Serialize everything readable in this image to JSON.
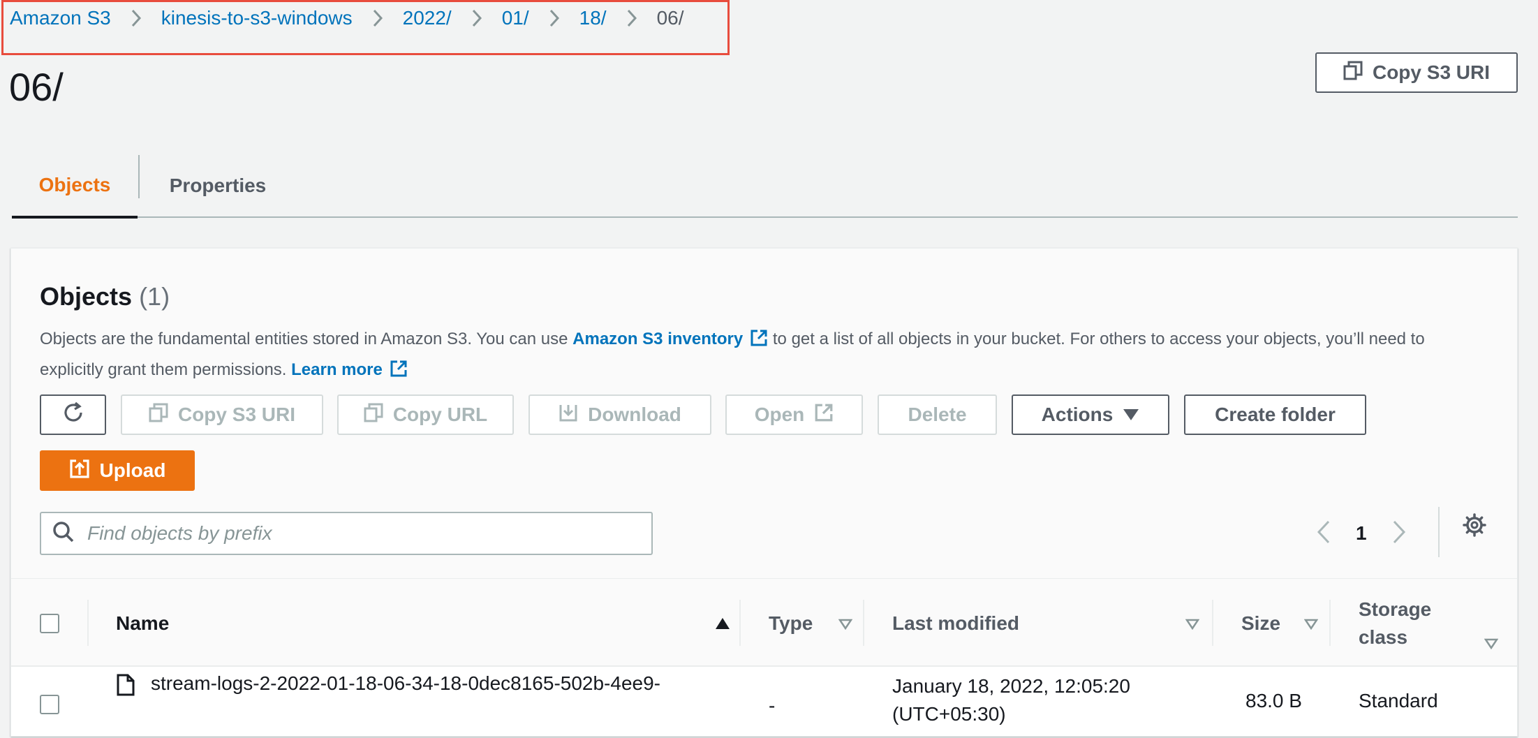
{
  "breadcrumb": [
    {
      "label": "Amazon S3"
    },
    {
      "label": "kinesis-to-s3-windows"
    },
    {
      "label": "2022/"
    },
    {
      "label": "01/"
    },
    {
      "label": "18/"
    },
    {
      "label": "06/"
    }
  ],
  "page": {
    "title": "06/",
    "copy_uri_label": "Copy S3 URI"
  },
  "tabs": [
    {
      "label": "Objects"
    },
    {
      "label": "Properties"
    }
  ],
  "objects_panel": {
    "title": "Objects",
    "count": "(1)",
    "desc_before": "Objects are the fundamental entities stored in Amazon S3. You can use ",
    "inventory_link": "Amazon S3 inventory",
    "desc_middle": " to get a list of all objects in your bucket. For others to access your objects, you’ll need to explicitly grant them permissions. ",
    "learn_more": "Learn more"
  },
  "toolbar": {
    "copy_s3_uri": "Copy S3 URI",
    "copy_url": "Copy URL",
    "download": "Download",
    "open": "Open",
    "delete": "Delete",
    "actions": "Actions",
    "create_folder": "Create folder",
    "upload": "Upload"
  },
  "search": {
    "placeholder": "Find objects by prefix",
    "value": ""
  },
  "pagination": {
    "current_page": "1"
  },
  "table": {
    "columns": {
      "name": "Name",
      "type": "Type",
      "last_modified": "Last modified",
      "size": "Size",
      "storage_class_line1": "Storage",
      "storage_class_line2": "class"
    },
    "rows": [
      {
        "name": "stream-logs-2-2022-01-18-06-34-18-0dec8165-502b-4ee9-",
        "type": "-",
        "last_modified_line1": "January 18, 2022, 12:05:20",
        "last_modified_line2": "(UTC+05:30)",
        "size": "83.0 B",
        "storage_class": "Standard"
      }
    ]
  },
  "colors": {
    "link": "#0073bb",
    "accent_orange": "#ec7211",
    "highlight_red": "#e84c3d",
    "text_dark": "#16191f",
    "text_grey": "#545b64"
  },
  "icons": {
    "breadcrumb_separator": "chevron-right-icon",
    "copy": "copy-icon",
    "refresh": "refresh-icon",
    "download": "download-icon",
    "external": "external-link-icon",
    "upload": "upload-icon",
    "search": "search-icon",
    "settings": "gear-icon",
    "file": "file-icon"
  }
}
